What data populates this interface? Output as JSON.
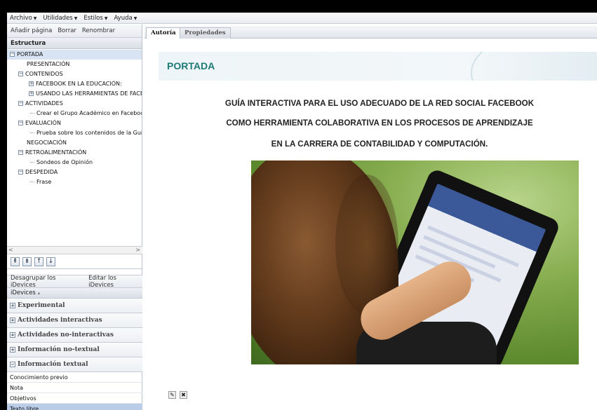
{
  "menubar": {
    "items": [
      {
        "label": "Archivo"
      },
      {
        "label": "Utilidades"
      },
      {
        "label": "Estilos"
      },
      {
        "label": "Ayuda"
      }
    ]
  },
  "outline_toolbar": {
    "add_page": "Añadir página",
    "delete": "Borrar",
    "rename": "Renombrar"
  },
  "structure": {
    "title": "Estructura",
    "nodes": [
      {
        "label": "PORTADA",
        "level": 0,
        "expander": "minus",
        "selected": true
      },
      {
        "label": "PRESENTACIÓN",
        "level": 1,
        "expander": "none"
      },
      {
        "label": "CONTENIDOS",
        "level": 1,
        "expander": "minus"
      },
      {
        "label": "FACEBOOK EN LA EDUCACIÓN:",
        "level": 2,
        "expander": "plus"
      },
      {
        "label": "USANDO LAS HERRAMIENTAS DE FACEB",
        "level": 2,
        "expander": "plus"
      },
      {
        "label": "ACTIVIDADES",
        "level": 1,
        "expander": "minus"
      },
      {
        "label": "Crear el Grupo Académico en Facebook",
        "level": 2,
        "expander": "none"
      },
      {
        "label": "EVALUACIÓN",
        "level": 1,
        "expander": "minus"
      },
      {
        "label": "Prueba sobre los contenidos de la Guía",
        "level": 2,
        "expander": "none"
      },
      {
        "label": "NEGOCIACIÓN",
        "level": 1,
        "expander": "none"
      },
      {
        "label": "RETROALIMENTACIÓN",
        "level": 1,
        "expander": "minus"
      },
      {
        "label": "Sondeos de Opinión",
        "level": 2,
        "expander": "none"
      },
      {
        "label": "DESPEDIDA",
        "level": 1,
        "expander": "minus"
      },
      {
        "label": "Frase",
        "level": 2,
        "expander": "none"
      }
    ]
  },
  "move_buttons": [
    "move-up",
    "move-down",
    "promote",
    "demote"
  ],
  "idevices_toolbar": {
    "ungroup": "Desagrupar los iDevices",
    "edit": "Editar los iDevices"
  },
  "idevices": {
    "title": "iDevices",
    "categories": [
      {
        "label": "Experimental",
        "expanded": false
      },
      {
        "label": "Actividades interactivas",
        "expanded": false
      },
      {
        "label": "Actividades no-interactivas",
        "expanded": false
      },
      {
        "label": "Información no-textual",
        "expanded": false
      },
      {
        "label": "Información textual",
        "expanded": true
      }
    ],
    "textual_items": [
      {
        "label": "Conocimiento previo",
        "selected": false
      },
      {
        "label": "Nota",
        "selected": false
      },
      {
        "label": "Objetivos",
        "selected": false
      },
      {
        "label": "Texto libre",
        "selected": true
      }
    ]
  },
  "tabs": [
    {
      "label": "Autoría",
      "active": true
    },
    {
      "label": "Propiedades",
      "active": false
    }
  ],
  "page": {
    "title": "PORTADA",
    "headline_1": "GUÍA INTERACTIVA PARA EL USO ADECUADO DE LA RED SOCIAL FACEBOOK",
    "headline_2": "COMO HERRAMIENTA COLABORATIVA EN LOS PROCESOS DE APRENDIZAJE",
    "headline_3": "EN LA CARRERA DE CONTABILIDAD Y COMPUTACIÓN.",
    "photo_alt": "woman-using-tablet-photo"
  },
  "colors": {
    "title_teal": "#1f7a76",
    "selection_blue": "#b9cde8"
  }
}
